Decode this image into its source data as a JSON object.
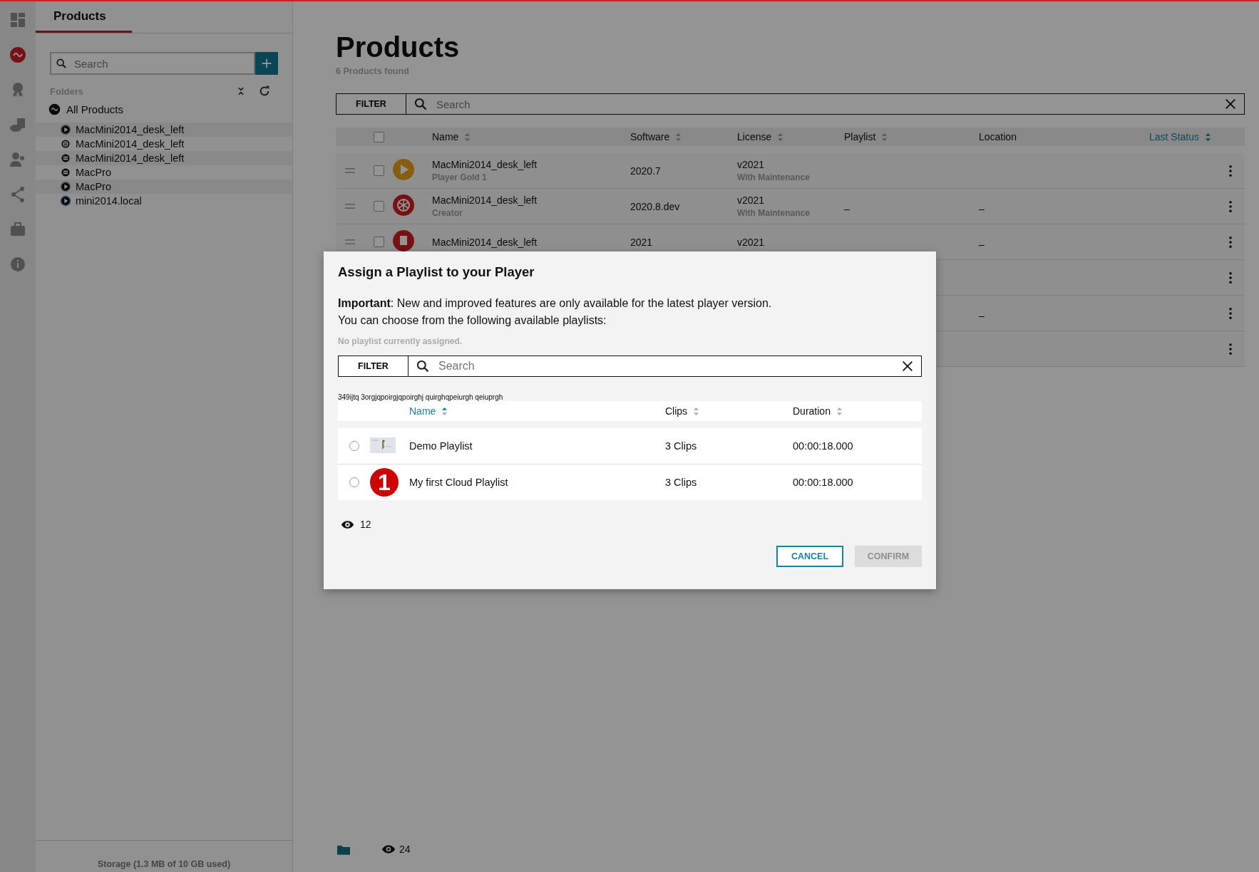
{
  "rail": [
    {
      "kind": "dashboard",
      "selected": false
    },
    {
      "kind": "products",
      "selected": true
    },
    {
      "kind": "award",
      "selected": false
    },
    {
      "kind": "cloud",
      "selected": false
    },
    {
      "kind": "users",
      "selected": false
    },
    {
      "kind": "share",
      "selected": false
    },
    {
      "kind": "briefcase",
      "selected": false
    },
    {
      "kind": "info",
      "selected": false
    }
  ],
  "sidebar": {
    "tab": "Products",
    "search": {
      "placeholder": "Search"
    },
    "folders_label": "Folders",
    "tree": {
      "label": "All Products",
      "children": [
        {
          "label": "MacMini2014_desk_left",
          "kind": "player"
        },
        {
          "label": "MacMini2014_desk_left",
          "kind": "creator"
        },
        {
          "label": "MacMini2014_desk_left",
          "kind": "server"
        },
        {
          "label": "MacPro",
          "kind": "server"
        },
        {
          "label": "MacPro",
          "kind": "player"
        },
        {
          "label": "mini2014.local",
          "kind": "online"
        }
      ]
    },
    "storage": "Storage (1.3 MB of 10 GB used)"
  },
  "main": {
    "title": "Products",
    "subtitle": "6 Products found",
    "filter": "FILTER",
    "search": {
      "placeholder": "Search"
    },
    "columns": [
      {
        "label": "Name",
        "sortable": true,
        "active": false
      },
      {
        "label": "Software",
        "sortable": true,
        "active": false
      },
      {
        "label": "License",
        "sortable": true,
        "active": false
      },
      {
        "label": "Playlist",
        "sortable": true,
        "active": false
      },
      {
        "label": "Location",
        "sortable": false,
        "active": false
      },
      {
        "label": "Last Status",
        "sortable": true,
        "active": true
      }
    ],
    "select_all_checked": false,
    "rows": [
      {
        "checked": false,
        "kind": "play",
        "name": "MacMini2014_desk_left",
        "sub": "Player Gold 1",
        "software": "2020.7",
        "license": "v2021",
        "license_sub": "With Maintenance"
      },
      {
        "checked": false,
        "kind": "creator",
        "name": "MacMini2014_desk_left",
        "sub": "Creator",
        "software": "2020.8.dev",
        "license": "v2021",
        "license_sub": "With Maintenance",
        "playlist": "–",
        "location": "–"
      },
      {
        "checked": false,
        "kind": "clipboard",
        "name": "MacMini2014_desk_left",
        "software": "2021",
        "license": "v2021",
        "location": "–"
      },
      {},
      {
        "location": "–"
      },
      {}
    ],
    "footer_count": "24"
  },
  "dialog": {
    "title": "Assign a Playlist to your Player",
    "text": "**Important**: New and improved features are only available for the latest player version.",
    "text2": "You can choose from the following available playlists:",
    "hint": "No playlist currently assigned.",
    "filter": "FILTER",
    "search": {
      "placeholder": "Search"
    },
    "note": "349ijtq 3orgjqpoirgjqpoirghj quirghqpeiurgh qeiuprgh",
    "columns": [
      {
        "label": "Name",
        "active": true
      },
      {
        "label": "Clips",
        "active": false
      },
      {
        "label": "Duration",
        "active": false
      }
    ],
    "rows": [
      {
        "selected": false,
        "kind": "picture",
        "name": "Demo Playlist",
        "clips": "3 Clips",
        "duration": "00:00:18.000"
      },
      {
        "selected": false,
        "kind": "badge",
        "badge": "1",
        "name": "My first Cloud Playlist",
        "clips": "3 Clips",
        "duration": "00:00:18.000"
      }
    ],
    "views": "12",
    "buttons": [
      {
        "label": "CANCEL",
        "disabled": false
      },
      {
        "label": "CONFIRM",
        "disabled": true
      }
    ]
  }
}
